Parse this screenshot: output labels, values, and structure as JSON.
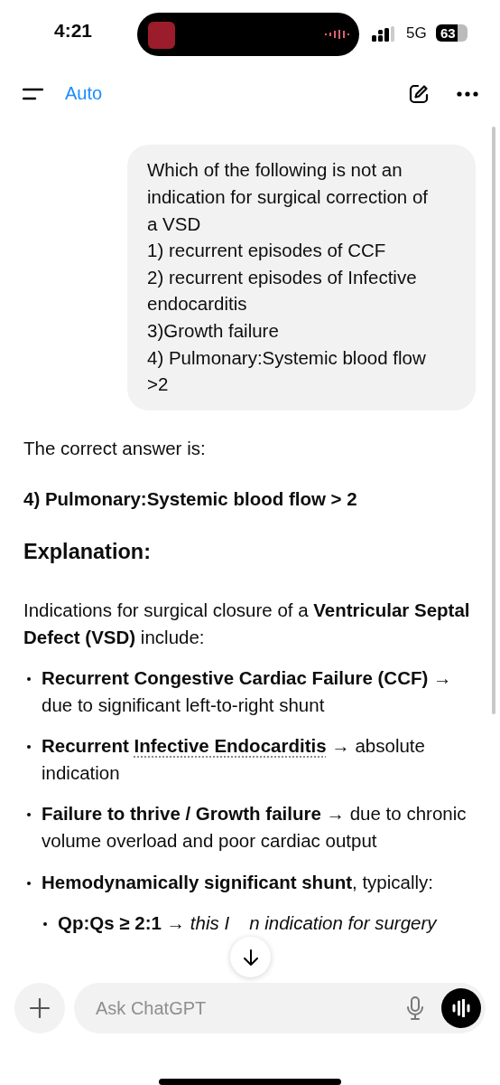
{
  "status_bar": {
    "time": "4:21",
    "network": "5G",
    "battery": "63"
  },
  "header": {
    "model": "Auto"
  },
  "user_message": {
    "text": "Which of the following is not an indication for surgical correction of a VSD\n1) recurrent episodes of CCF\n2) recurrent episodes of Infective endocarditis\n3)Growth failure\n4) Pulmonary:Systemic blood flow >2"
  },
  "reply": {
    "intro": "The correct answer is:",
    "answer": "4) Pulmonary:Systemic blood flow > 2",
    "heading": "Explanation:",
    "paragraph": "Indications for surgical closure of a **Ventricular Septal Defect (VSD)** include:",
    "bullets": [
      {
        "segments": [
          {
            "kind": "bold",
            "text": "Recurrent Congestive Cardiac Failure (CCF)"
          },
          {
            "kind": "plain",
            "text": " → due to significant left-to-right shunt"
          }
        ]
      },
      {
        "segments": [
          {
            "kind": "bold",
            "text": "Recurrent "
          },
          {
            "kind": "link",
            "text": "Infective Endocarditis"
          },
          {
            "kind": "plain",
            "text": " → absolute indication"
          }
        ]
      },
      {
        "segments": [
          {
            "kind": "bold",
            "text": "Failure to thrive / Growth failure"
          },
          {
            "kind": "plain",
            "text": " → due to chronic volume overload and poor cardiac output"
          }
        ]
      },
      {
        "segments": [
          {
            "kind": "bold",
            "text": "Hemodynamically significant shunt"
          },
          {
            "kind": "plain",
            "text": ", typically:"
          }
        ],
        "children": [
          {
            "segments": [
              {
                "kind": "bold",
                "text": "Qp:Qs ≥ 2:1"
              },
              {
                "kind": "plain",
                "text": " → "
              },
              {
                "kind": "covered",
                "text": "this I"
              },
              {
                "kind": "italic",
                "text": "n indication for surgery"
              }
            ]
          }
        ]
      }
    ]
  },
  "composer": {
    "placeholder": "Ask ChatGPT"
  }
}
